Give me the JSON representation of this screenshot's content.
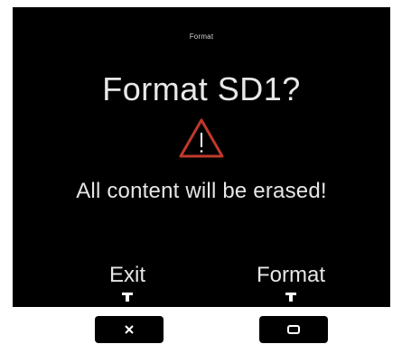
{
  "header": {
    "title": "Format"
  },
  "dialog": {
    "question": "Format SD1?",
    "warning_icon": "warning-triangle-icon",
    "message": "All content will be erased!"
  },
  "softkeys": {
    "left_label": "Exit",
    "right_label": "Format"
  },
  "hardware_buttons": {
    "left_icon": "close-x-icon",
    "right_icon": "square-icon"
  },
  "colors": {
    "screen_bg": "#000000",
    "text": "#e6e6e6",
    "warning": "#c0392b"
  }
}
